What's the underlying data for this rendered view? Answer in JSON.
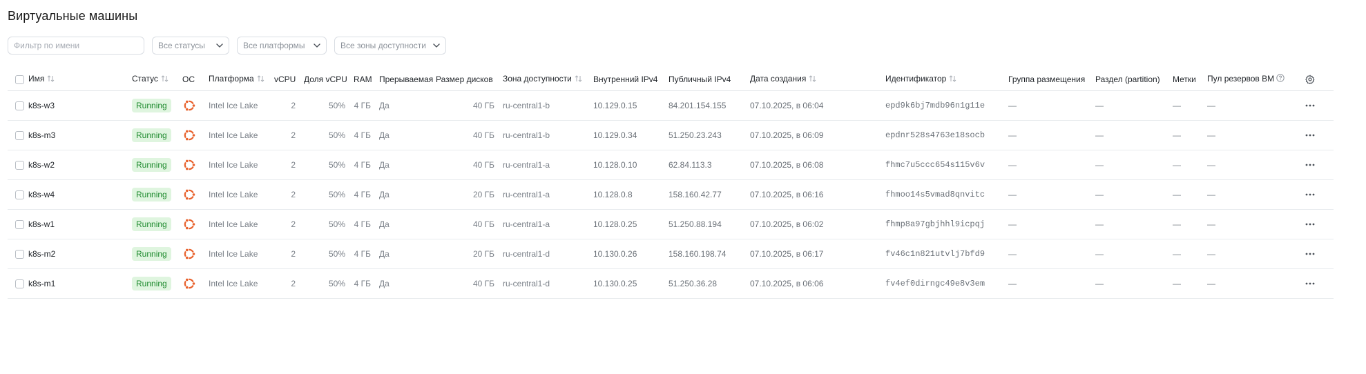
{
  "page": {
    "title": "Виртуальные машины"
  },
  "filters": {
    "name_placeholder": "Фильтр по имени",
    "status_label": "Все статусы",
    "platform_label": "Все платформы",
    "zone_label": "Все зоны доступности"
  },
  "table": {
    "columns": {
      "name": "Имя",
      "status": "Статус",
      "os": "ОС",
      "platform": "Платформа",
      "vcpu": "vCPU",
      "vcpu_share": "Доля vCPU",
      "ram": "RAM",
      "preemptible": "Прерываемая",
      "disk_size": "Размер дисков",
      "zone": "Зона доступности",
      "internal_ipv4": "Внутренний IPv4",
      "public_ipv4": "Публичный IPv4",
      "created": "Дата создания",
      "id": "Идентификатор",
      "placement_group": "Группа размещения",
      "partition": "Раздел (partition)",
      "labels": "Метки",
      "reserve_pool": "Пул резервов ВМ"
    },
    "rows": [
      {
        "name": "k8s-w3",
        "status": "Running",
        "os_icon": "ubuntu-icon",
        "platform": "Intel Ice Lake",
        "vcpu": "2",
        "vcpu_share": "50%",
        "ram": "4 ГБ",
        "preemptible": "Да",
        "disk_size": "40 ГБ",
        "zone": "ru-central1-b",
        "internal_ipv4": "10.129.0.15",
        "public_ipv4": "84.201.154.155",
        "created": "07.10.2025, в 06:04",
        "id": "epd9k6bj7mdb96n1g11e",
        "placement_group": "—",
        "partition": "—",
        "labels": "—",
        "reserve_pool": "—"
      },
      {
        "name": "k8s-m3",
        "status": "Running",
        "os_icon": "ubuntu-icon",
        "platform": "Intel Ice Lake",
        "vcpu": "2",
        "vcpu_share": "50%",
        "ram": "4 ГБ",
        "preemptible": "Да",
        "disk_size": "40 ГБ",
        "zone": "ru-central1-b",
        "internal_ipv4": "10.129.0.34",
        "public_ipv4": "51.250.23.243",
        "created": "07.10.2025, в 06:09",
        "id": "epdnr528s4763e18socb",
        "placement_group": "—",
        "partition": "—",
        "labels": "—",
        "reserve_pool": "—"
      },
      {
        "name": "k8s-w2",
        "status": "Running",
        "os_icon": "ubuntu-icon",
        "platform": "Intel Ice Lake",
        "vcpu": "2",
        "vcpu_share": "50%",
        "ram": "4 ГБ",
        "preemptible": "Да",
        "disk_size": "40 ГБ",
        "zone": "ru-central1-a",
        "internal_ipv4": "10.128.0.10",
        "public_ipv4": "62.84.113.3",
        "created": "07.10.2025, в 06:08",
        "id": "fhmc7u5ccc654s115v6v",
        "placement_group": "—",
        "partition": "—",
        "labels": "—",
        "reserve_pool": "—"
      },
      {
        "name": "k8s-w4",
        "status": "Running",
        "os_icon": "ubuntu-icon",
        "platform": "Intel Ice Lake",
        "vcpu": "2",
        "vcpu_share": "50%",
        "ram": "4 ГБ",
        "preemptible": "Да",
        "disk_size": "20 ГБ",
        "zone": "ru-central1-a",
        "internal_ipv4": "10.128.0.8",
        "public_ipv4": "158.160.42.77",
        "created": "07.10.2025, в 06:16",
        "id": "fhmoo14s5vmad8qnvitc",
        "placement_group": "—",
        "partition": "—",
        "labels": "—",
        "reserve_pool": "—"
      },
      {
        "name": "k8s-w1",
        "status": "Running",
        "os_icon": "ubuntu-icon",
        "platform": "Intel Ice Lake",
        "vcpu": "2",
        "vcpu_share": "50%",
        "ram": "4 ГБ",
        "preemptible": "Да",
        "disk_size": "40 ГБ",
        "zone": "ru-central1-a",
        "internal_ipv4": "10.128.0.25",
        "public_ipv4": "51.250.88.194",
        "created": "07.10.2025, в 06:02",
        "id": "fhmp8a97gbjhhl9icpqj",
        "placement_group": "—",
        "partition": "—",
        "labels": "—",
        "reserve_pool": "—"
      },
      {
        "name": "k8s-m2",
        "status": "Running",
        "os_icon": "ubuntu-icon",
        "platform": "Intel Ice Lake",
        "vcpu": "2",
        "vcpu_share": "50%",
        "ram": "4 ГБ",
        "preemptible": "Да",
        "disk_size": "20 ГБ",
        "zone": "ru-central1-d",
        "internal_ipv4": "10.130.0.26",
        "public_ipv4": "158.160.198.74",
        "created": "07.10.2025, в 06:17",
        "id": "fv46c1n821utvlj7bfd9",
        "placement_group": "—",
        "partition": "—",
        "labels": "—",
        "reserve_pool": "—"
      },
      {
        "name": "k8s-m1",
        "status": "Running",
        "os_icon": "ubuntu-icon",
        "platform": "Intel Ice Lake",
        "vcpu": "2",
        "vcpu_share": "50%",
        "ram": "4 ГБ",
        "preemptible": "Да",
        "disk_size": "40 ГБ",
        "zone": "ru-central1-d",
        "internal_ipv4": "10.130.0.25",
        "public_ipv4": "51.250.36.28",
        "created": "07.10.2025, в 06:06",
        "id": "fv4ef0dirngc49e8v3em",
        "placement_group": "—",
        "partition": "—",
        "labels": "—",
        "reserve_pool": "—"
      }
    ]
  },
  "colors": {
    "status_running_bg": "#dff5df",
    "status_running_text": "#1e8a2e",
    "ubuntu_orange": "#e8612c",
    "border": "#e8ebee"
  }
}
